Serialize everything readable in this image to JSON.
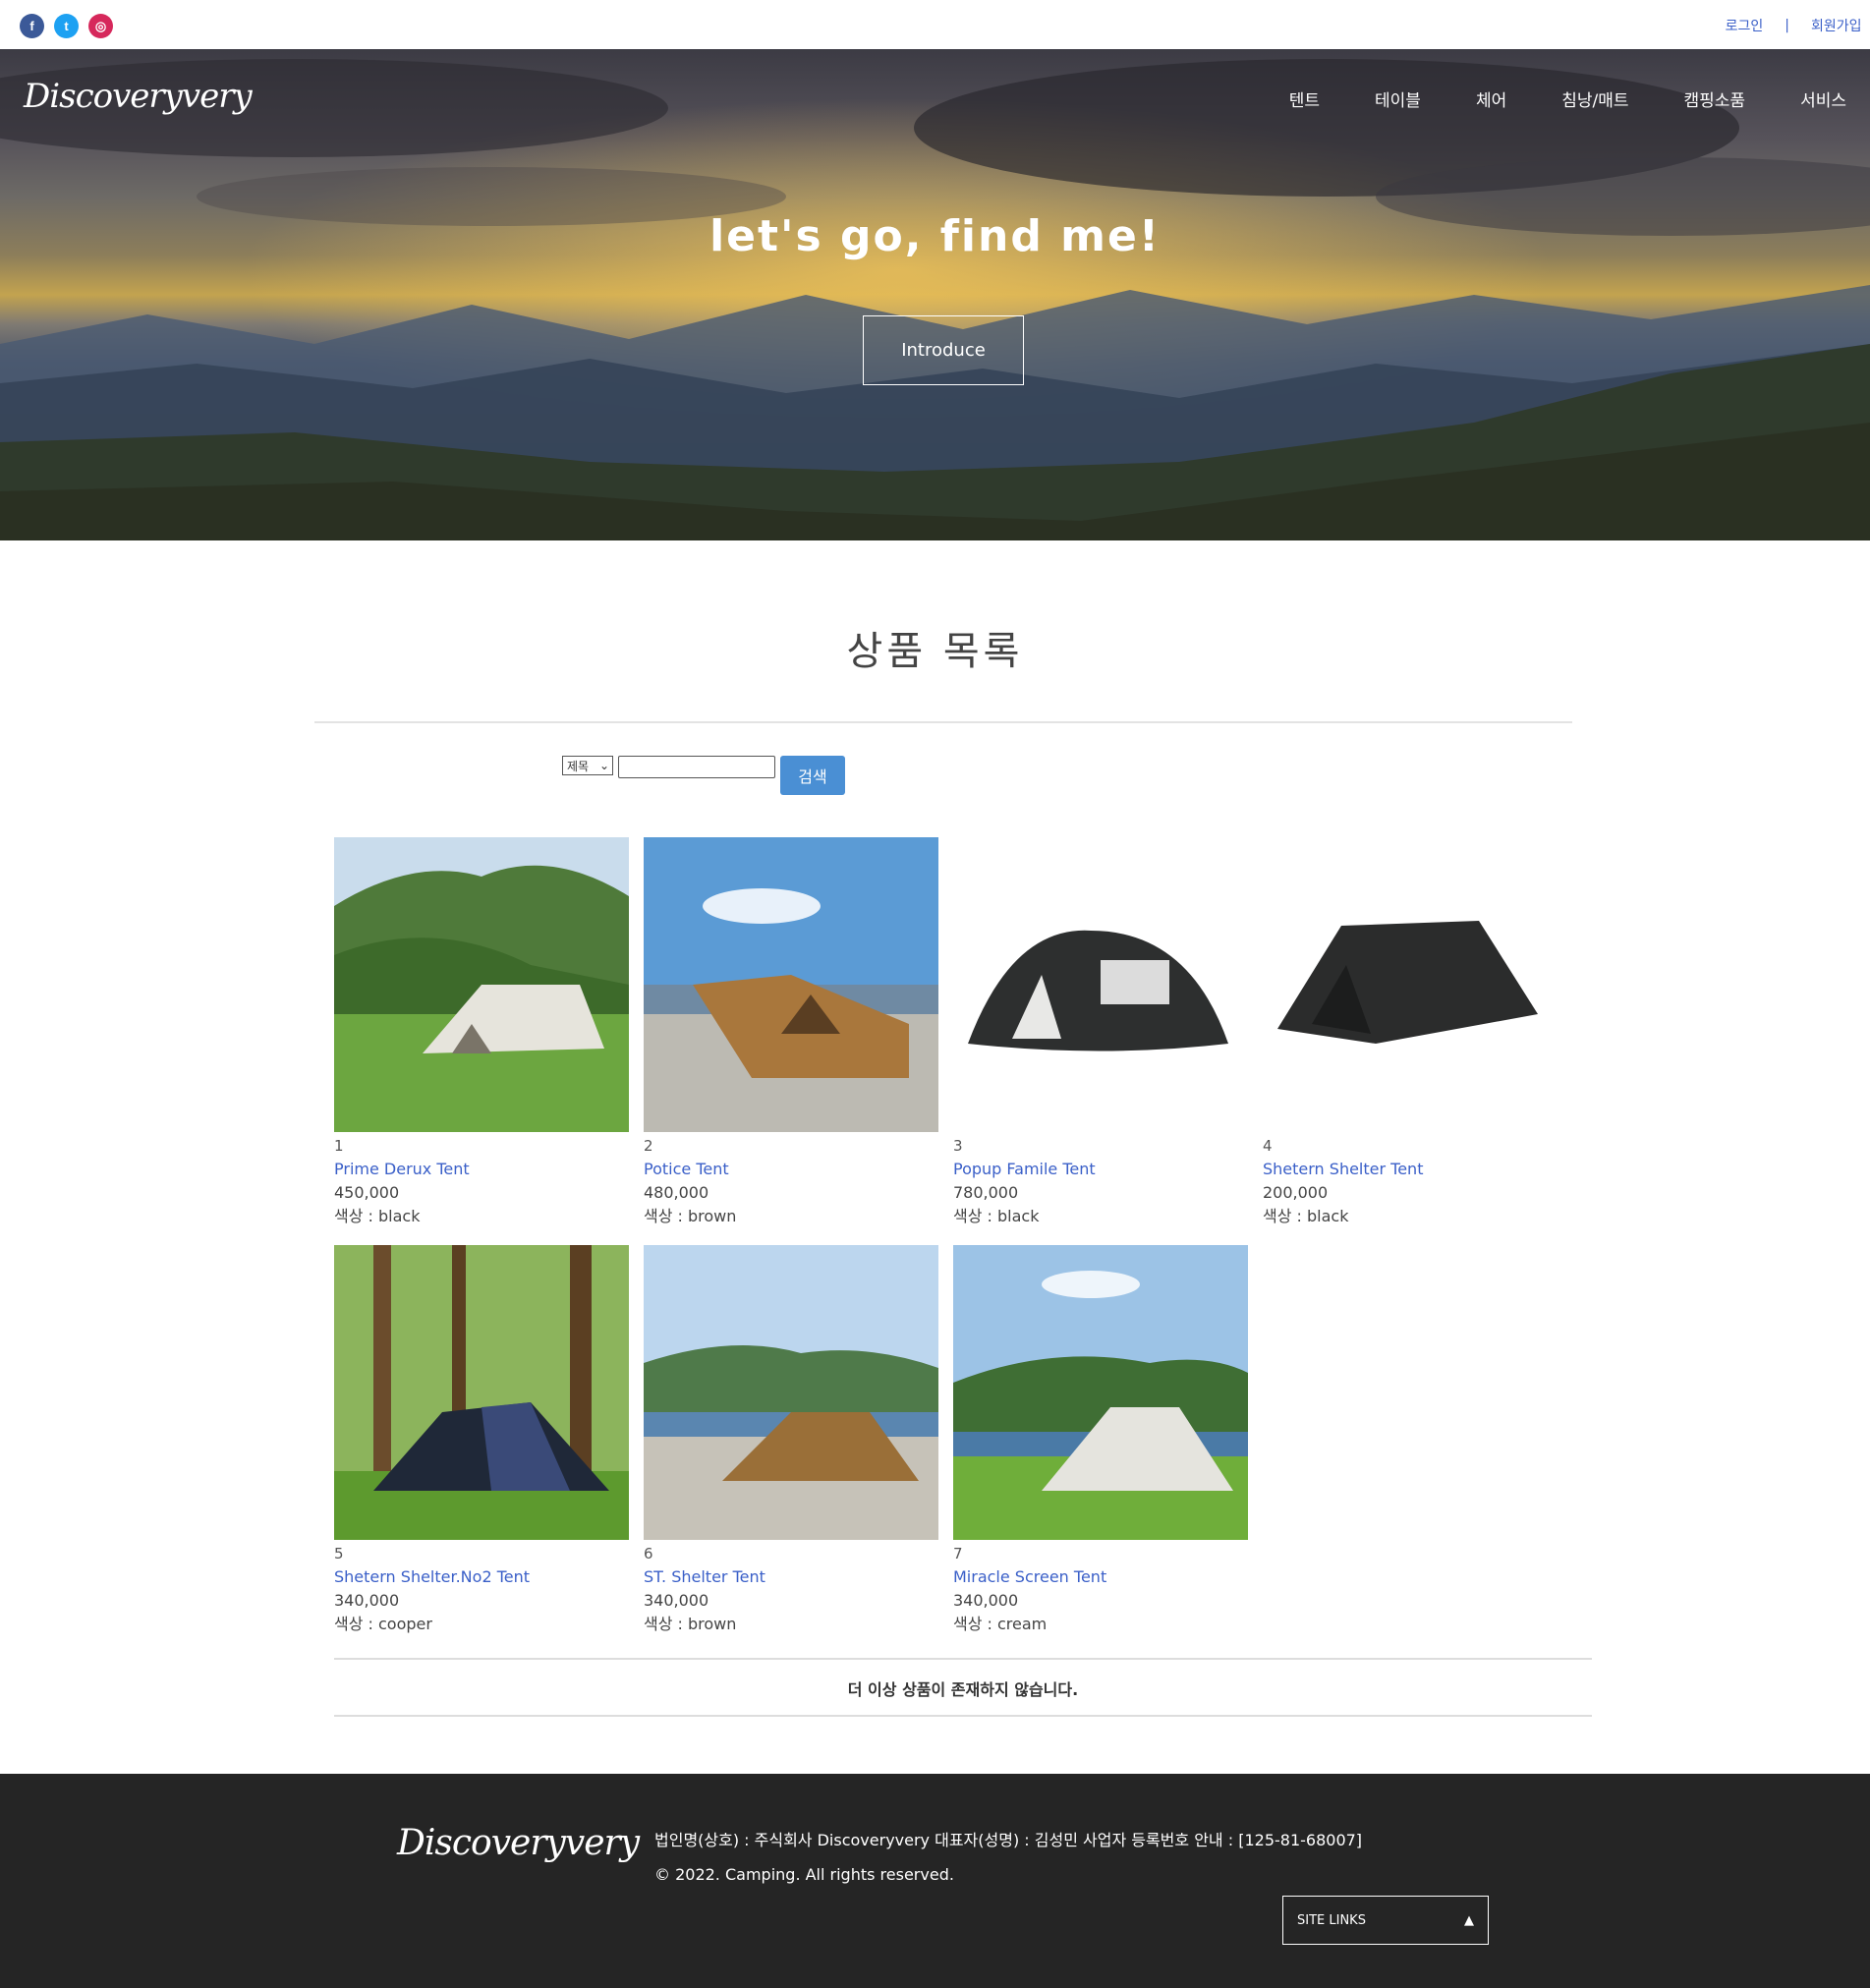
{
  "topbar": {
    "social": [
      {
        "name": "facebook-icon",
        "glyph": "f"
      },
      {
        "name": "twitter-icon",
        "glyph": "t"
      },
      {
        "name": "instagram-icon",
        "glyph": "◎"
      }
    ],
    "login_label": "로그인",
    "separator": "|",
    "signup_label": "회원가입"
  },
  "hero": {
    "logo": "Discoveryvery",
    "nav": [
      "텐트",
      "테이블",
      "체어",
      "침낭/매트",
      "캠핑소품",
      "서비스"
    ],
    "title": "let's go, find me!",
    "button_label": "Introduce"
  },
  "main": {
    "title": "상품 목록",
    "search": {
      "select_value": "제목",
      "input_value": "",
      "button_label": "검색"
    },
    "products": [
      {
        "no": "1",
        "name": "Prime Derux Tent",
        "price": "450,000",
        "color": "색상 : black"
      },
      {
        "no": "2",
        "name": "Potice Tent",
        "price": "480,000",
        "color": "색상 : brown"
      },
      {
        "no": "3",
        "name": "Popup Famile Tent",
        "price": "780,000",
        "color": "색상 : black"
      },
      {
        "no": "4",
        "name": "Shetern Shelter Tent",
        "price": "200,000",
        "color": "색상 : black"
      },
      {
        "no": "5",
        "name": "Shetern Shelter.No2 Tent",
        "price": "340,000",
        "color": "색상 : cooper"
      },
      {
        "no": "6",
        "name": "ST. Shelter Tent",
        "price": "340,000",
        "color": "색상 : brown"
      },
      {
        "no": "7",
        "name": "Miracle Screen Tent",
        "price": "340,000",
        "color": "색상 : cream"
      }
    ],
    "end_message": "더 이상 상품이 존재하지 않습니다."
  },
  "footer": {
    "logo": "Discoveryvery",
    "company_line": "법인명(상호) : 주식회사 Discoveryvery 대표자(성명) : 김성민 사업자 등록번호 안내 : [125-81-68007]",
    "copyright": "© 2022. Camping. All rights reserved.",
    "site_links_label": "SITE LINKS"
  },
  "colors": {
    "link": "#3a5fc8",
    "search_button": "#4a8fd4",
    "footer_bg": "#252525"
  }
}
